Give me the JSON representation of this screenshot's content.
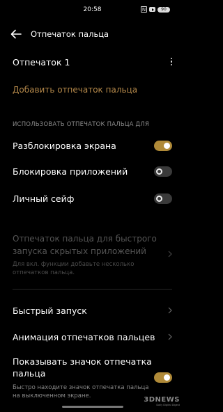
{
  "status_bar": {
    "time": "20:58",
    "icons": [
      "nfc-icon",
      "youtube-icon",
      "battery-icon"
    ],
    "nfc_glyph": "N",
    "battery_level": "90"
  },
  "header": {
    "title": "Отпечаток пальца",
    "back_icon": "back-arrow-icon"
  },
  "fingerprints": [
    {
      "label": "Отпечаток 1",
      "menu_icon": "more-vert-icon"
    }
  ],
  "add_fingerprint": "Добавить отпечаток пальца",
  "use_section": {
    "header": "ИСПОЛЬЗОВАТЬ ОТПЕЧАТОК ПАЛЬЦА ДЛЯ",
    "items": [
      {
        "label": "Разблокировка экрана",
        "on": true
      },
      {
        "label": "Блокировка приложений",
        "on": false
      },
      {
        "label": "Личный сейф",
        "on": false
      }
    ]
  },
  "hidden_apps": {
    "title": "Отпечаток пальца для быстрого запуска скрытых приложений",
    "subtitle": "Для вкл. функции добавьте несколько отпечатков пальца."
  },
  "quick_launch": {
    "label": "Быстрый запуск"
  },
  "animation": {
    "label": "Анимация отпечатков пальцев"
  },
  "show_icon": {
    "title": "Показывать значок отпечатка пальца",
    "subtitle": "Быстро находите значок отпечатка пальца на выключенном экране.",
    "on": true
  },
  "watermark": {
    "main": "3DNEWS",
    "sub": "Daily Digital Digest"
  },
  "colors": {
    "background": "#000000",
    "accent": "#b08a38",
    "link": "#b5894a",
    "text_primary": "#ffffff",
    "text_secondary": "#8a8a8a",
    "text_disabled": "#555555"
  }
}
